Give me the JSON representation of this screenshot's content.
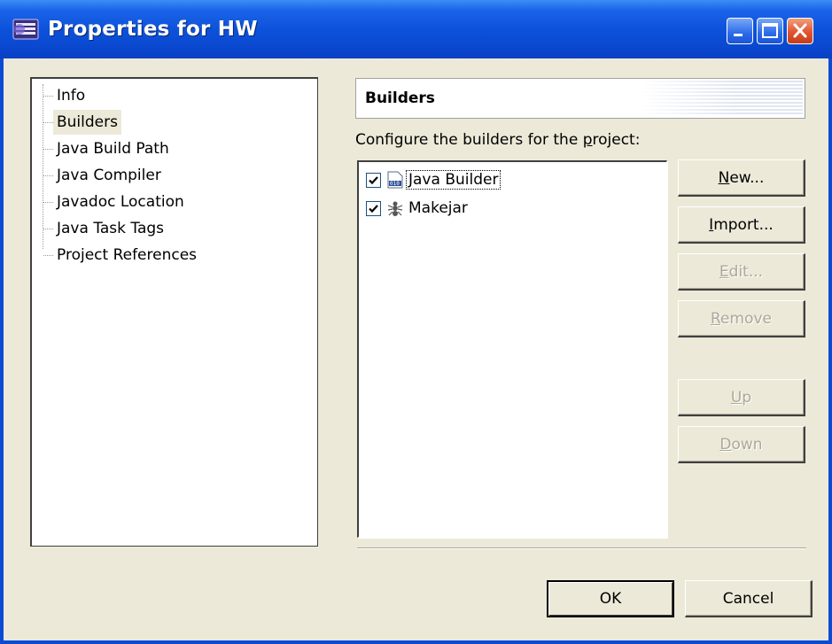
{
  "window": {
    "title": "Properties for HW",
    "controls": [
      "minimize",
      "maximize",
      "close"
    ],
    "accent": "#0a48cf"
  },
  "tree": {
    "items": [
      {
        "label": "Info",
        "selected": false
      },
      {
        "label": "Builders",
        "selected": true
      },
      {
        "label": "Java Build Path",
        "selected": false
      },
      {
        "label": "Java Compiler",
        "selected": false
      },
      {
        "label": "Javadoc Location",
        "selected": false
      },
      {
        "label": "Java Task Tags",
        "selected": false
      },
      {
        "label": "Project References",
        "selected": false
      }
    ]
  },
  "page": {
    "header_title": "Builders",
    "description_pre": "Configure the builders for the ",
    "description_mnemonic": "p",
    "description_post": "roject:"
  },
  "builders": [
    {
      "label": "Java Builder",
      "checked": true,
      "icon": "java-builder-icon"
    },
    {
      "label": "Makejar",
      "checked": true,
      "icon": "ant-builder-icon"
    }
  ],
  "buttons": {
    "new": {
      "mn": "N",
      "rest": "ew...",
      "enabled": true
    },
    "import": {
      "mn": "I",
      "rest": "mport...",
      "enabled": true
    },
    "edit": {
      "mn": "E",
      "rest": "dit...",
      "enabled": false
    },
    "remove": {
      "mn": "R",
      "rest": "emove",
      "enabled": false
    },
    "up": {
      "mn": "U",
      "rest": "p",
      "enabled": false
    },
    "down": {
      "mn": "D",
      "rest": "own",
      "enabled": false
    },
    "ok": "OK",
    "cancel": "Cancel"
  }
}
